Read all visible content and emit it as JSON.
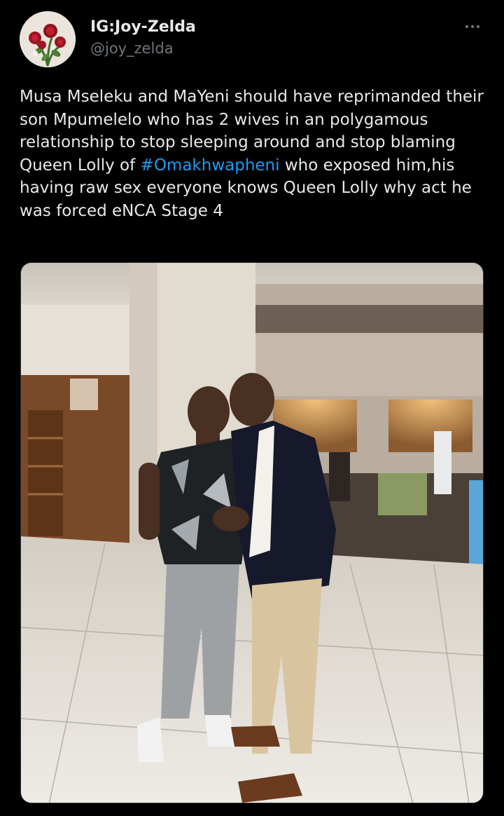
{
  "tweet": {
    "display_name": "IG:Joy-Zelda",
    "handle": "@joy_zelda",
    "avatar_icon": "rose-bouquet-avatar",
    "more_icon": "more-options-icon",
    "text_part1": "Musa Mseleku and MaYeni should have reprimanded their son Mpumelelo who has 2 wives in an polygamous relationship to stop sleeping around and stop blaming Queen Lolly of ",
    "hashtag": "#Omakhwapheni",
    "text_part2": " who exposed him,his having raw sex everyone knows Queen Lolly why act he was forced eNCA Stage 4",
    "media_description_icon": "photo-image"
  },
  "colors": {
    "background": "#000000",
    "text": "#e7e9ea",
    "secondary_text": "#71767b",
    "link": "#1d9bf0"
  }
}
